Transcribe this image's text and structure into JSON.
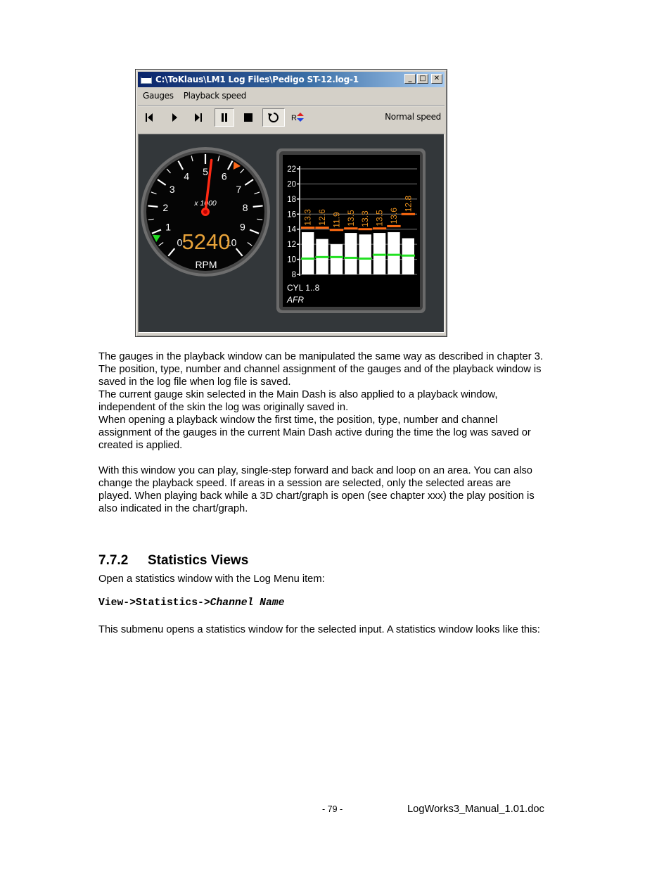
{
  "window": {
    "title": "C:\\ToKlaus\\LM1 Log Files\\Pedigo ST-12.log-1",
    "menu": [
      "Gauges",
      "Playback speed"
    ],
    "speed_label": "Normal speed",
    "toolbar_icons": [
      "skip-back-icon",
      "play-icon",
      "step-forward-icon",
      "pause-icon",
      "stop-icon",
      "loop-icon",
      "reverse-icon"
    ],
    "loop_button_pressed": true,
    "rpm_gauge": {
      "scale_labels": [
        "0",
        "1",
        "2",
        "3",
        "4",
        "5",
        "6",
        "7",
        "8",
        "9",
        "10"
      ],
      "multiplier": "x 1000",
      "value": "5240",
      "unit": "RPM",
      "needle_value": 5.24,
      "scale_max": 10,
      "colors": {
        "value": "#e8a33a",
        "needle": "#ff2a14",
        "marker_high": "#ff6a1a",
        "marker_low": "#22dd22"
      }
    },
    "afr_gauge": {
      "y_ticks": [
        "22",
        "20",
        "18",
        "16",
        "14",
        "12",
        "10",
        "8"
      ],
      "y_min": 8,
      "y_max": 22,
      "bars": [
        13.6,
        12.7,
        12.0,
        13.5,
        13.3,
        13.5,
        13.6,
        12.8
      ],
      "labels": [
        "13.3",
        "12.6",
        "11.9",
        "13.5",
        "13.3",
        "13.5",
        "13.6",
        "12.8"
      ],
      "high_markers": [
        14.2,
        14.2,
        13.9,
        14.1,
        14.0,
        14.1,
        14.4,
        16.0
      ],
      "low_markers": [
        10.1,
        10.3,
        10.3,
        10.2,
        10.1,
        10.6,
        10.6,
        10.5
      ],
      "caption": "CYL 1..8",
      "unit": "AFR",
      "colors": {
        "bar": "#ffffff",
        "label": "#e8901e",
        "high": "#ff6a10",
        "low": "#22e022"
      }
    }
  },
  "paragraphs": [
    [
      "The gauges in the playback window can be manipulated the same way as described in chapter 3.",
      "The position, type, number and channel assignment of the gauges and of the playback window is",
      "saved in the log file when log file is saved.",
      "The current gauge skin selected in the Main Dash is also applied to a playback window,",
      "independent of the skin the log was originally saved in.",
      "When opening a playback window the first time, the position, type, number and channel",
      "assignment of the gauges in the current Main Dash active during the time the log was saved or",
      "created is applied."
    ],
    [
      "With this window you can play, single-step forward and back and loop on an area. You can also",
      "change the playback speed. If areas in a session are selected, only the selected areas are",
      "played. When playing back while a 3D chart/graph is open (see chapter xxx) the play position is",
      "also indicated in the chart/graph."
    ]
  ],
  "section": {
    "number": "7.7.2",
    "title": "Statistics Views",
    "intro": "Open a statistics window with the Log Menu item:",
    "menu_path_prefix": "View->Statistics->",
    "menu_path_item": "Channel Name",
    "after": "This submenu opens a statistics window for the selected input. A statistics window looks like this:"
  },
  "footer": {
    "page": "- 79 -",
    "document": "LogWorks3_Manual_1.01.doc"
  }
}
